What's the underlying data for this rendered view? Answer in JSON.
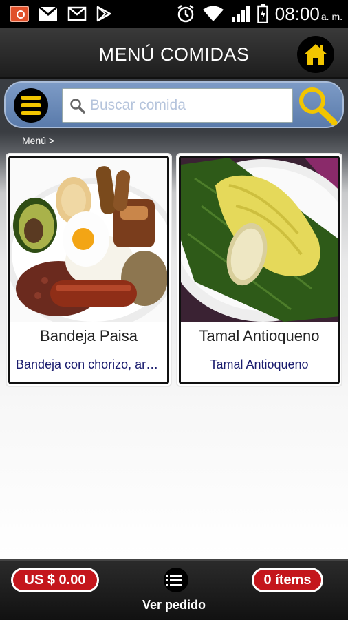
{
  "status_bar": {
    "time": "08:00",
    "ampm": "a. m.",
    "icons": [
      "photo-icon",
      "gmail-icon",
      "mail-icon",
      "play-store-icon",
      "alarm-icon",
      "wifi-icon",
      "signal-icon",
      "battery-icon"
    ]
  },
  "header": {
    "title": "MENÚ COMIDAS",
    "home_icon": "home-icon"
  },
  "search": {
    "placeholder": "Buscar comida",
    "value": ""
  },
  "breadcrumb": "Menú >",
  "products": [
    {
      "name": "Bandeja Paisa",
      "description": "Bandeja con chorizo, arroz, frijoles y huevo"
    },
    {
      "name": "Tamal Antioqueno",
      "description": "Tamal Antioqueno"
    }
  ],
  "footer": {
    "total": "US $ 0.00",
    "items": "0 ítems",
    "order_label": "Ver pedido"
  },
  "colors": {
    "accent_yellow": "#f2c500",
    "pill_red": "#c4161c",
    "search_blue": "#6a8bb9",
    "desc_text": "#1a1c6e"
  }
}
